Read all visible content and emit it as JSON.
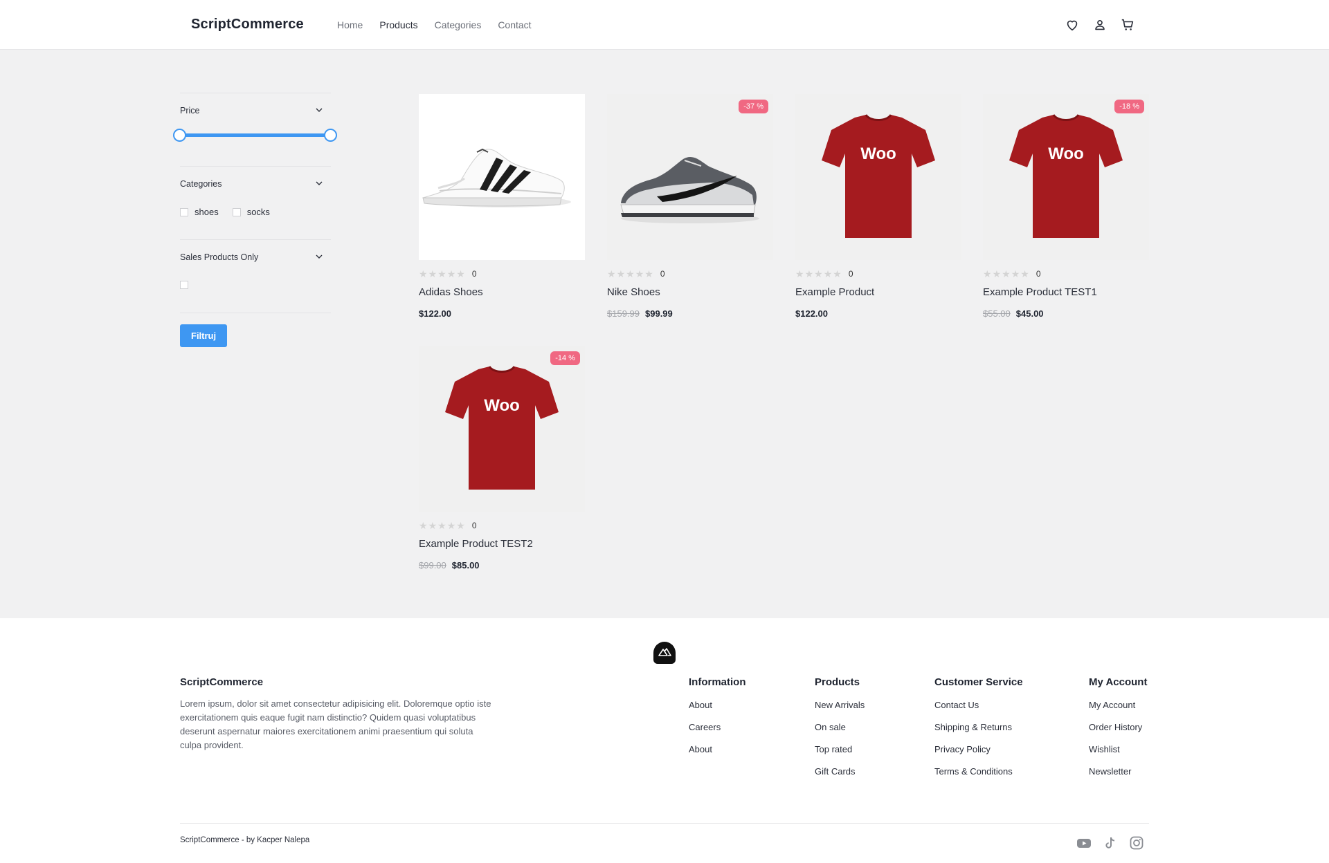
{
  "header": {
    "brand": "ScriptCommerce",
    "nav": [
      "Home",
      "Products",
      "Categories",
      "Contact"
    ],
    "active_nav": "Products",
    "icons": [
      "heart-icon",
      "user-icon",
      "cart-icon"
    ]
  },
  "filters": {
    "price": {
      "title": "Price"
    },
    "categories": {
      "title": "Categories",
      "options": [
        "shoes",
        "socks"
      ]
    },
    "sales": {
      "title": "Sales Products Only"
    },
    "button_label": "Filtruj",
    "accent_color": "#3e97f2"
  },
  "products": [
    {
      "name": "Adidas Shoes",
      "rating_count": "0",
      "old_price": "",
      "price": "$122.00",
      "badge": ""
    },
    {
      "name": "Nike Shoes",
      "rating_count": "0",
      "old_price": "$159.99",
      "price": "$99.99",
      "badge": "-37 %"
    },
    {
      "name": "Example Product",
      "rating_count": "0",
      "old_price": "",
      "price": "$122.00",
      "badge": ""
    },
    {
      "name": "Example Product TEST1",
      "rating_count": "0",
      "old_price": "$55.00",
      "price": "$45.00",
      "badge": "-18 %"
    },
    {
      "name": "Example Product TEST2",
      "rating_count": "0",
      "old_price": "$99.00",
      "price": "$85.00",
      "badge": "-14 %"
    }
  ],
  "footer": {
    "brand": "ScriptCommerce",
    "description": "Lorem ipsum, dolor sit amet consectetur adipisicing elit. Doloremque optio iste exercitationem quis eaque fugit nam distinctio? Quidem quasi voluptatibus deserunt aspernatur maiores exercitationem animi praesentium qui soluta culpa provident.",
    "columns": [
      {
        "title": "Information",
        "links": [
          "About",
          "Careers",
          "About"
        ]
      },
      {
        "title": "Products",
        "links": [
          "New Arrivals",
          "On sale",
          "Top rated",
          "Gift Cards"
        ]
      },
      {
        "title": "Customer Service",
        "links": [
          "Contact Us",
          "Shipping & Returns",
          "Privacy Policy",
          "Terms & Conditions"
        ]
      },
      {
        "title": "My Account",
        "links": [
          "My Account",
          "Order History",
          "Wishlist",
          "Newsletter"
        ]
      }
    ],
    "copyright": "ScriptCommerce - by Kacper Nalepa",
    "socials": [
      "youtube-icon",
      "tiktok-icon",
      "instagram-icon"
    ]
  },
  "colors": {
    "badge": "#f06882",
    "tshirt": "#a51b1f"
  }
}
